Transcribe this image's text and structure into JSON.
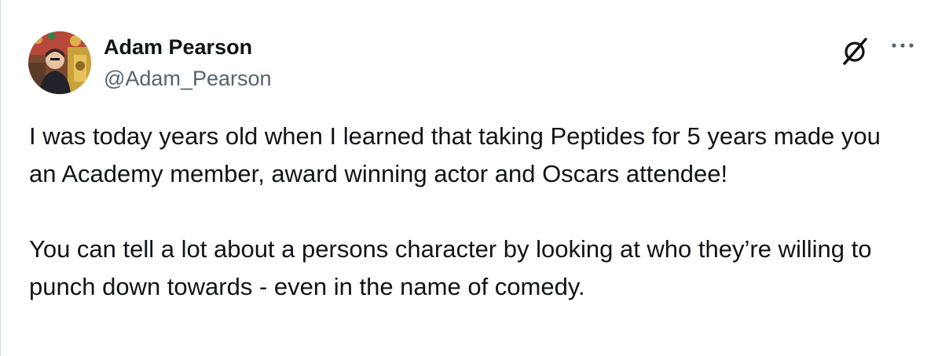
{
  "author": {
    "display_name": "Adam Pearson",
    "handle": "@Adam_Pearson",
    "avatar_icon": "profile-photo"
  },
  "actions": {
    "grok_icon": "grok-icon",
    "more_icon": "more-options-icon"
  },
  "tweet": {
    "paragraphs": [
      "I was today years old when I learned that taking Peptides for 5 years made you an Academy member, award winning actor and Oscars attendee!",
      "You can tell a lot about a persons character by looking at who they’re willing to punch down towards - even in the name of comedy."
    ]
  },
  "colors": {
    "text": "#0f1419",
    "secondary_text": "#536471",
    "border": "#cfd9de",
    "background": "#ffffff"
  }
}
